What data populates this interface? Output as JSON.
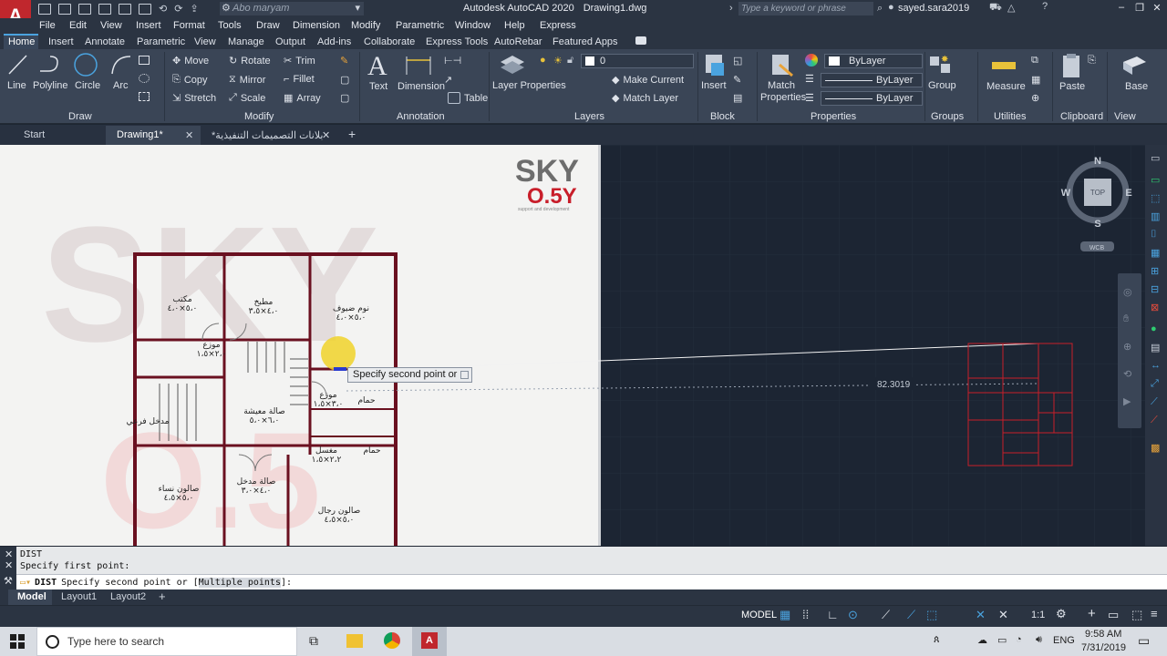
{
  "titlebar": {
    "workspace": "Abo maryam",
    "app_title": "Autodesk AutoCAD 2020",
    "doc_title": "Drawing1.dwg",
    "search_placeholder": "Type a keyword or phrase",
    "user": "sayed.sara2019"
  },
  "menu": [
    "File",
    "Edit",
    "View",
    "Insert",
    "Format",
    "Tools",
    "Draw",
    "Dimension",
    "Modify",
    "Parametric",
    "Window",
    "Help",
    "Express"
  ],
  "ribbon_tabs": [
    "Home",
    "Insert",
    "Annotate",
    "Parametric",
    "View",
    "Manage",
    "Output",
    "Add-ins",
    "Collaborate",
    "Express Tools",
    "AutoRebar",
    "Featured Apps"
  ],
  "ribbon": {
    "draw": {
      "line": "Line",
      "polyline": "Polyline",
      "circle": "Circle",
      "arc": "Arc",
      "panel": "Draw"
    },
    "modify": {
      "move": "Move",
      "rotate": "Rotate",
      "trim": "Trim",
      "copy": "Copy",
      "mirror": "Mirror",
      "fillet": "Fillet",
      "stretch": "Stretch",
      "scale": "Scale",
      "array": "Array",
      "panel": "Modify"
    },
    "annotation": {
      "text": "Text",
      "dimension": "Dimension",
      "table": "Table",
      "panel": "Annotation"
    },
    "layers": {
      "layer_properties": "Layer Properties",
      "layer_current": "0",
      "make_current": "Make Current",
      "match_layer": "Match Layer",
      "panel": "Layers"
    },
    "block": {
      "insert": "Insert",
      "panel": "Block"
    },
    "properties": {
      "match": "Match Properties",
      "color": "ByLayer",
      "linetype": "ByLayer",
      "lineweight": "ByLayer",
      "panel": "Properties"
    },
    "groups": {
      "group": "Group",
      "panel": "Groups"
    },
    "utilities": {
      "measure": "Measure",
      "panel": "Utilities"
    },
    "clipboard": {
      "paste": "Paste",
      "panel": "Clipboard"
    },
    "view": {
      "base": "Base",
      "panel": "View"
    }
  },
  "doc_tabs": {
    "start": "Start",
    "drawing1": "Drawing1*",
    "arabic": "*بلانات التصميمات التنفيذية"
  },
  "viewcube": {
    "n": "N",
    "s": "S",
    "e": "E",
    "w": "W",
    "top": "TOP",
    "wcs": "WCB"
  },
  "logo": {
    "sky": "SKY",
    "version": "O.5Y",
    "tagline": "support and development"
  },
  "floor_plan": {
    "rooms": [
      "مكتب",
      "مطبخ",
      "نوم ضيوف",
      "موزع",
      "صالة معيشة",
      "موزع",
      "حمام",
      "صالة مدخل",
      "صالون نساء",
      "صالون رجال",
      "مدخل فرعي",
      "حمام",
      "مغسل"
    ],
    "dims": [
      "٥،٠×٤،٠",
      "٤،٠×٣،٥",
      "٥،٠×٤،٠",
      "٢،٠×١،٥",
      "٦،٠×٥،٠",
      "٣،٠×١،٥",
      "٤،٠×٣،٠",
      "٥،٠×٤،٥",
      "٥،٠×٤،٥",
      "٢،٢×١،٥"
    ]
  },
  "dist_label": "82.3019",
  "tooltip": "Specify second point or",
  "command": {
    "line1": "DIST",
    "line2": "Specify first point:",
    "prompt_cmd": "DIST",
    "prompt_text": "Specify second point or [",
    "prompt_option": "Multiple points",
    "prompt_end": "]:"
  },
  "layout_tabs": [
    "Model",
    "Layout1",
    "Layout2"
  ],
  "status": {
    "model": "MODEL",
    "scale": "1:1"
  },
  "taskbar": {
    "search": "Type here to search",
    "lang": "ENG",
    "time": "9:58 AM",
    "date": "7/31/2019"
  },
  "colors": {
    "accent": "#4aa3df",
    "autocad_red": "#c0272d",
    "wall": "#8b1a2a",
    "plan_red": "#c81e2a"
  }
}
